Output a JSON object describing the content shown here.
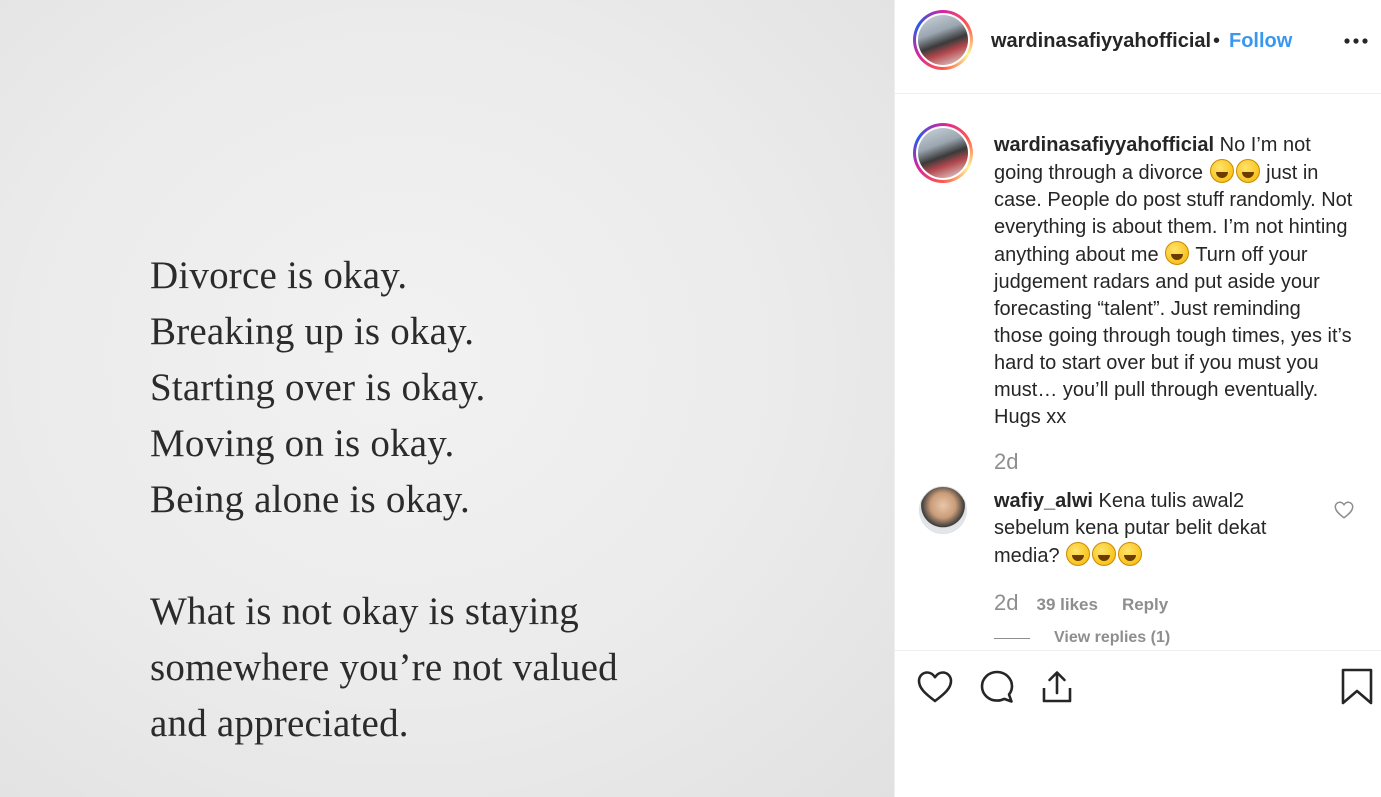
{
  "quote": {
    "lines": [
      "Divorce is okay.",
      "Breaking up is okay.",
      "Starting over is okay.",
      "Moving on is okay.",
      "Being alone is okay.",
      "",
      "What is not okay is staying",
      "somewhere you’re not valued",
      "and appreciated."
    ]
  },
  "header": {
    "username": "wardinasafiyyahofficial",
    "separator": "•",
    "follow_label": "Follow",
    "more_icon": "more-horizontal-icon"
  },
  "caption": {
    "username": "wardinasafiyyahofficial",
    "part1": " No I’m not going through a divorce ",
    "part2": " just in case. People do post stuff randomly. Not everything is about them. I’m not hinting anything about me ",
    "part3": " Turn off your judgement radars and put aside your forecasting “talent”. Just reminding those going through tough times, yes it’s hard to start over but if you must you must… you’ll pull through eventually. Hugs xx",
    "time": "2d"
  },
  "comment": {
    "username": "wafiy_alwi",
    "text": " Kena tulis awal2 sebelum kena putar belit dekat media? ",
    "time": "2d",
    "likes": "39 likes",
    "reply_label": "Reply",
    "view_replies": "View replies (1)"
  },
  "actions": {
    "like_icon": "heart-icon",
    "comment_icon": "comment-icon",
    "share_icon": "share-icon",
    "save_icon": "bookmark-icon"
  },
  "colors": {
    "link": "#3897f0",
    "muted": "#8e8e8e",
    "text": "#262626"
  }
}
